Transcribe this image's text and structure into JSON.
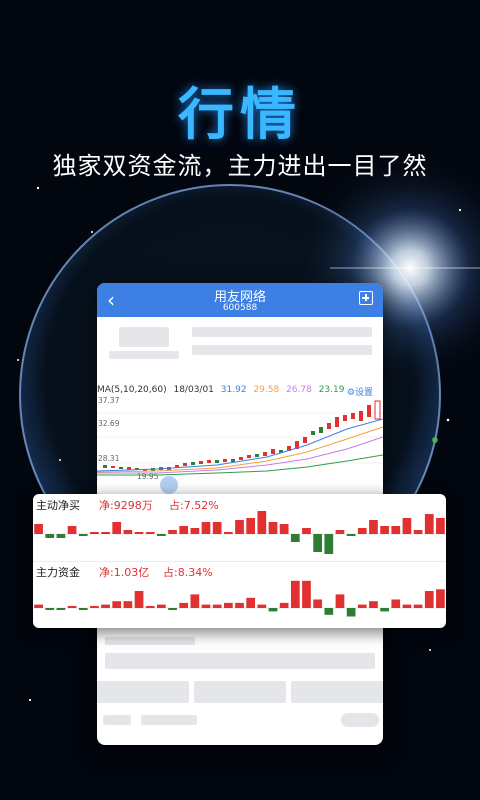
{
  "promo": {
    "headline": "行情",
    "subline": "独家双资金流，主力进出一目了然"
  },
  "phone": {
    "title": "用友网络",
    "code": "600588",
    "ma_line": {
      "label": "MA(5,10,20,60)",
      "date": "18/03/01",
      "ma5": "31.92",
      "ma10": "29.58",
      "ma20": "26.78",
      "ma60": "23.19",
      "settings": "⚙设置"
    },
    "price_axis": [
      "37.37",
      "32.69",
      "28.31"
    ],
    "low_label": "19.95"
  },
  "colors": {
    "up": "#e03030",
    "down": "#2e7d32",
    "ma5": "#3d7fe3",
    "ma10": "#f2a43a",
    "ma20": "#c77de8",
    "ma60": "#2e9d4e"
  },
  "flow_panel": {
    "net_buy": {
      "title": "主动净买",
      "value": "净:9298万",
      "percent": "占:7.52%",
      "bars": [
        0.5,
        -0.2,
        -0.2,
        0.4,
        -0.1,
        0.1,
        0.1,
        0.6,
        0.2,
        0.1,
        0.1,
        -0.1,
        0.2,
        0.4,
        0.3,
        0.6,
        0.6,
        0.1,
        0.7,
        0.8,
        1.2,
        0.6,
        0.5,
        -0.4,
        0.3,
        -0.9,
        -1.0,
        0.2,
        -0.1,
        0.3,
        0.7,
        0.4,
        0.4,
        0.8,
        0.2,
        1.0,
        0.8
      ]
    },
    "main_fund": {
      "title": "主力资金",
      "value": "净:1.03亿",
      "percent": "占:8.34%",
      "bars": [
        0.2,
        -0.1,
        -0.1,
        0.1,
        -0.1,
        0.1,
        0.2,
        0.4,
        0.4,
        1.0,
        0.1,
        0.2,
        -0.1,
        0.3,
        0.8,
        0.2,
        0.2,
        0.3,
        0.3,
        0.6,
        0.2,
        -0.2,
        0.3,
        1.6,
        1.6,
        0.5,
        -0.4,
        0.8,
        -0.5,
        0.2,
        0.4,
        -0.2,
        0.5,
        0.2,
        0.2,
        1.0,
        1.1
      ]
    }
  }
}
